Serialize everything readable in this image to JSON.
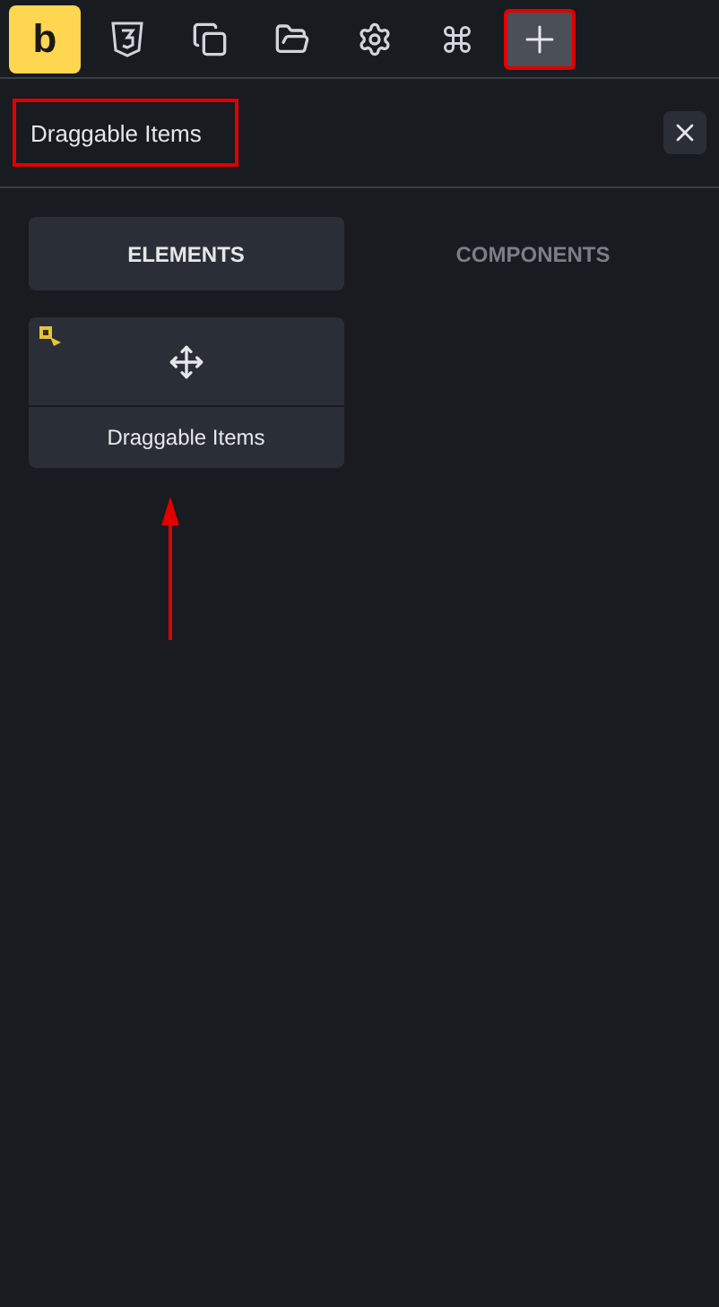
{
  "toolbar": {
    "logo": "b",
    "buttons": [
      {
        "selected": false,
        "highlighted": false
      },
      {
        "selected": false,
        "highlighted": false
      },
      {
        "selected": false,
        "highlighted": false
      },
      {
        "selected": false,
        "highlighted": false
      },
      {
        "selected": false,
        "highlighted": false
      },
      {
        "selected": true,
        "highlighted": true
      }
    ]
  },
  "search": {
    "value": "Draggable Items",
    "highlighted": true
  },
  "tabs": [
    {
      "label": "ELEMENTS",
      "selected": true
    },
    {
      "label": "COMPONENTS",
      "selected": false
    }
  ],
  "elements": [
    {
      "label": "Draggable Items",
      "pointed": true
    }
  ]
}
